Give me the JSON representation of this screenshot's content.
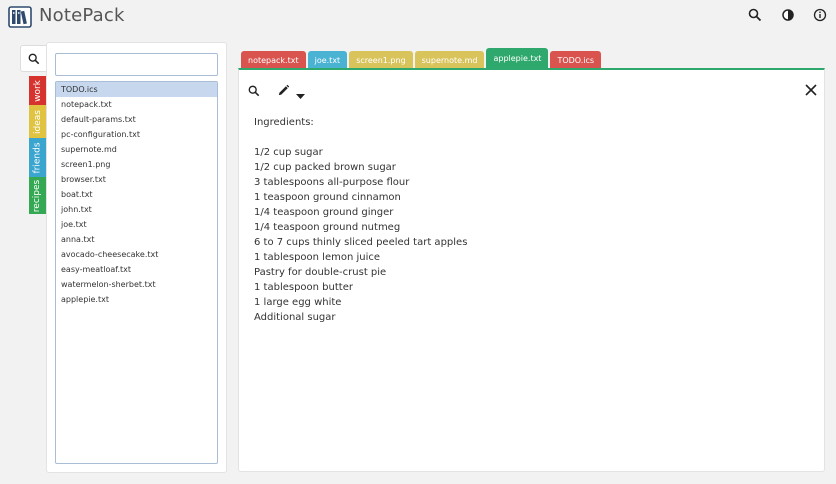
{
  "app": {
    "title": "NotePack"
  },
  "header": {
    "icons": [
      "search-icon",
      "contrast-icon",
      "info-icon"
    ]
  },
  "categories": [
    {
      "label": "work",
      "color": "#d6332e"
    },
    {
      "label": "ideas",
      "color": "#e0c341"
    },
    {
      "label": "friends",
      "color": "#3aa5cf"
    },
    {
      "label": "recipes",
      "color": "#34a853"
    }
  ],
  "search": {
    "value": "",
    "placeholder": ""
  },
  "files": [
    {
      "name": "TODO.ics"
    },
    {
      "name": "notepack.txt"
    },
    {
      "name": "default-params.txt"
    },
    {
      "name": "pc-configuration.txt"
    },
    {
      "name": "supernote.md"
    },
    {
      "name": "screen1.png"
    },
    {
      "name": "browser.txt"
    },
    {
      "name": "boat.txt"
    },
    {
      "name": "john.txt"
    },
    {
      "name": "joe.txt"
    },
    {
      "name": "anna.txt"
    },
    {
      "name": "avocado-cheesecake.txt"
    },
    {
      "name": "easy-meatloaf.txt"
    },
    {
      "name": "watermelon-sherbet.txt"
    },
    {
      "name": "applepie.txt"
    }
  ],
  "selected_file": "TODO.ics",
  "tabs": [
    {
      "label": "notepack.txt",
      "color": "#d9534f"
    },
    {
      "label": "joe.txt",
      "color": "#4ab3d4"
    },
    {
      "label": "screen1.png",
      "color": "#d9c35b"
    },
    {
      "label": "supernote.md",
      "color": "#d9c35b"
    },
    {
      "label": "applepie.txt",
      "color": "#2fa86d"
    },
    {
      "label": "TODO.ics",
      "color": "#d9534f"
    }
  ],
  "active_tab": "applepie.txt",
  "editor": {
    "content": "Ingredients:\n\n1/2 cup sugar\n1/2 cup packed brown sugar\n3 tablespoons all-purpose flour\n1 teaspoon ground cinnamon\n1/4 teaspoon ground ginger\n1/4 teaspoon ground nutmeg\n6 to 7 cups thinly sliced peeled tart apples\n1 tablespoon lemon juice\nPastry for double-crust pie\n1 tablespoon butter\n1 large egg white\nAdditional sugar",
    "toolbar_icons": [
      "search-icon",
      "pencil-icon",
      "caret-down-icon",
      "close-icon"
    ]
  }
}
